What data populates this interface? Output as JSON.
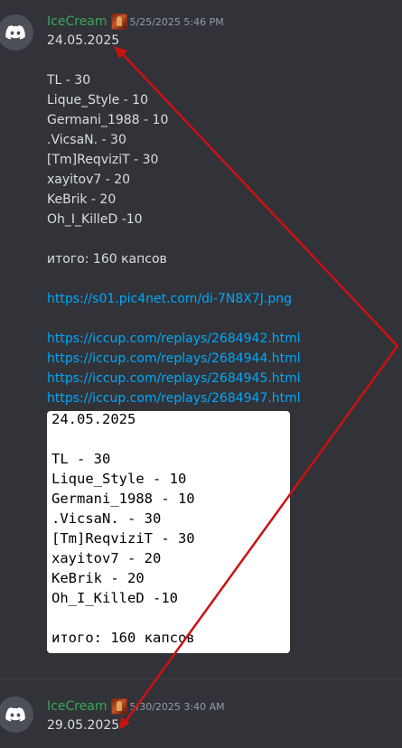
{
  "messages": [
    {
      "author": "IceCream",
      "timestamp": "5/25/2025 5:46 PM",
      "lines": [
        "24.05.2025",
        "TL - 30",
        "Lique_Style - 10",
        "Germani_1988 - 10",
        ".VicsaN. - 30",
        "[Tm]ReqviziT - 30",
        "xayitov7 - 20",
        "KeBrik - 20",
        "Oh_I_KilleD -10",
        "итого: 160 капсов"
      ],
      "links": [
        "https://s01.pic4net.com/di-7N8X7J.png",
        "https://iccup.com/replays/2684942.html",
        "https://iccup.com/replays/2684944.html",
        "https://iccup.com/replays/2684945.html",
        "https://iccup.com/replays/2684947.html"
      ],
      "attachment_lines": [
        "24.05.2025",
        "TL - 30",
        "Lique_Style - 10",
        "Germani_1988 - 10",
        ".VicsaN. - 30",
        "[Tm]ReqviziT - 30",
        "xayitov7 - 20",
        "KeBrik - 20",
        "Oh_I_KilleD -10",
        "итого: 160 капсов"
      ]
    },
    {
      "author": "IceCream",
      "timestamp": "5/30/2025 3:40 AM",
      "lines": [
        "29.05.2025"
      ]
    }
  ],
  "icons": {
    "avatar": "discord-logo-icon",
    "role": "role-badge-icon"
  },
  "colors": {
    "background": "#313338",
    "username": "#3ba55c",
    "link": "#00a8fc",
    "annotation_arrow": "#cc1111"
  }
}
